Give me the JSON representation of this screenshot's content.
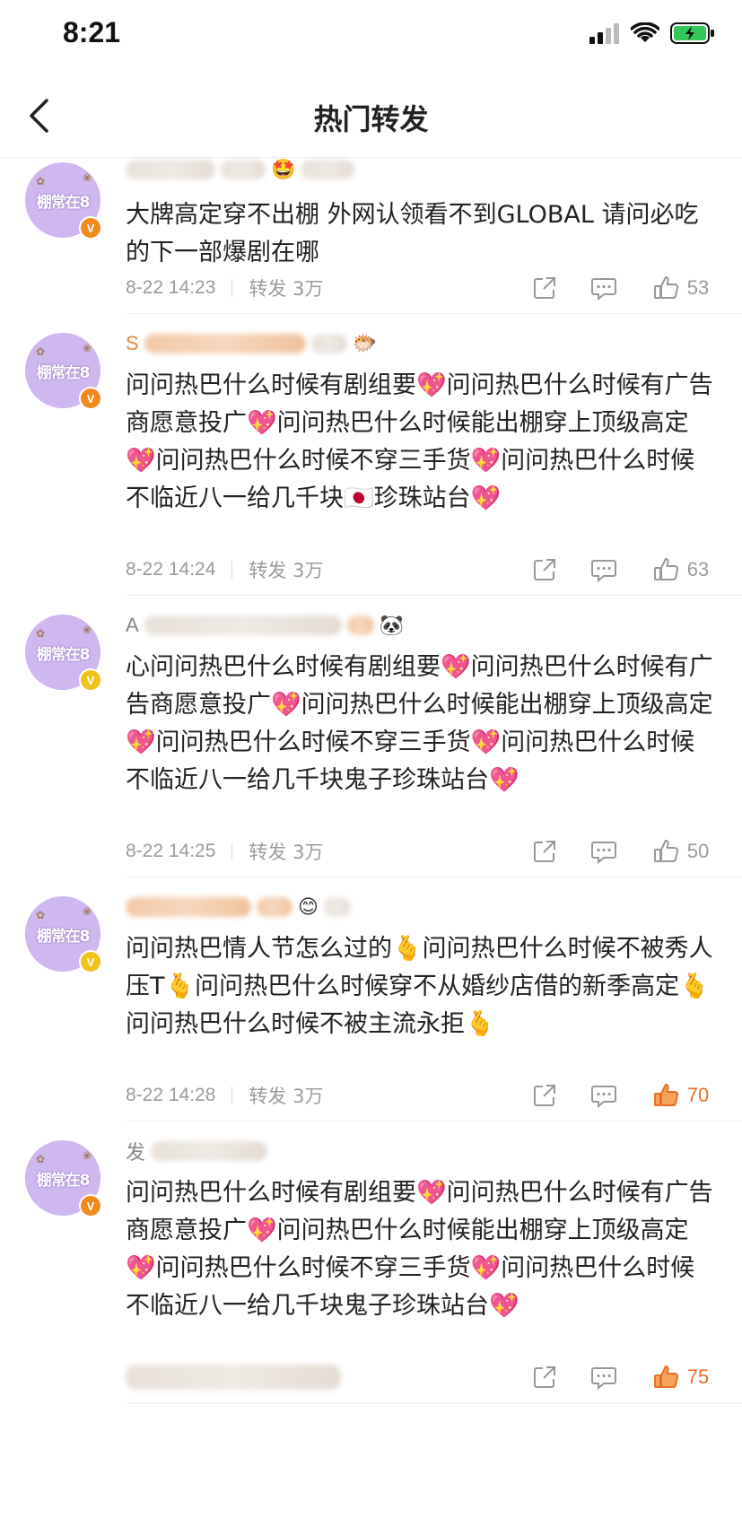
{
  "status_bar": {
    "time": "8:21"
  },
  "nav": {
    "title": "热门转发"
  },
  "colors": {
    "accent": "#e86f23",
    "avatar_bg": "#cfb7ef",
    "badge_orange": "#f08a1c",
    "badge_yellow": "#f2c21b"
  },
  "items": [
    {
      "avatar_text": "棚常在8",
      "username_initial": "",
      "name_emoji": "🤩",
      "content": "大牌高定穿不出棚 外网认领看不到GLOBAL 请问必吃的下一部爆剧在哪",
      "time": "8-22 14:23",
      "repost": "转发 3万",
      "likes": "53",
      "liked": false
    },
    {
      "avatar_text": "棚常在8",
      "username_initial": "S",
      "name_emoji": "🐡",
      "content": "问问热巴什么时候有剧组要💖问问热巴什么时候有广告商愿意投广💖问问热巴什么时候能出棚穿上顶级高定💖问问热巴什么时候不穿三手货💖问问热巴什么时候不临近八一给几千块🇯🇵珍珠站台💖",
      "time": "8-22 14:24",
      "repost": "转发 3万",
      "likes": "63",
      "liked": false
    },
    {
      "avatar_text": "棚常在8",
      "username_initial": "A",
      "name_emoji": "🐼",
      "content": "心问问热巴什么时候有剧组要💖问问热巴什么时候有广告商愿意投广💖问问热巴什么时候能出棚穿上顶级高定💖问问热巴什么时候不穿三手货💖问问热巴什么时候不临近八一给几千块鬼子珍珠站台💖",
      "time": "8-22 14:25",
      "repost": "转发 3万",
      "likes": "50",
      "liked": false
    },
    {
      "avatar_text": "棚常在8",
      "username_initial": "",
      "name_emoji": "😊",
      "content": "问问热巴情人节怎么过的🫰问问热巴什么时候不被秀人压T🫰问问热巴什么时候穿不从婚纱店借的新季高定🫰问问热巴什么时候不被主流永拒🫰",
      "time": "8-22 14:28",
      "repost": "转发 3万",
      "likes": "70",
      "liked": true
    },
    {
      "avatar_text": "棚常在8",
      "username_initial": "发",
      "name_emoji": "",
      "content": "问问热巴什么时候有剧组要💖问问热巴什么时候有广告商愿意投广💖问问热巴什么时候能出棚穿上顶级高定💖问问热巴什么时候不穿三手货💖问问热巴什么时候不临近八一给几千块鬼子珍珠站台💖",
      "time": "",
      "repost": "",
      "likes": "75",
      "liked": true
    }
  ]
}
